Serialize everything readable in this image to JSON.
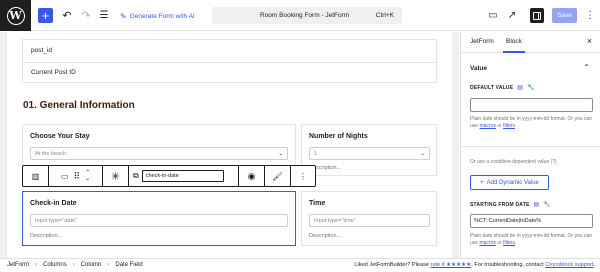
{
  "topbar": {
    "add_icon": "plus-icon",
    "undo_icon": "undo-icon",
    "redo_icon": "redo-icon",
    "outline_icon": "list-view-icon",
    "generate_label": "Generate Form with AI",
    "doc_title": "Room Booking Form - JetForm",
    "doc_shortcut": "Ctrl+K",
    "save_label": "Save",
    "accent": "#3858e9"
  },
  "canvas": {
    "post_id_label": "post_id",
    "current_post_label": "Current Post ID",
    "section_title": "01. General Information",
    "stay": {
      "label": "Choose Your Stay",
      "value": "At the beach",
      "desc": "Description..."
    },
    "nights": {
      "label": "Number of Nights",
      "value": "1",
      "desc": "Description..."
    },
    "checkin": {
      "label": "Check-in Date",
      "placeholder": "Input type=\"date\"",
      "desc": "Description..."
    },
    "time": {
      "label": "Time",
      "placeholder": "Input type=\"time\"",
      "desc": "Description..."
    },
    "block_toolbar": {
      "name_value": "check-in-date"
    }
  },
  "sidebar": {
    "tabs": [
      "JetForm",
      "Block"
    ],
    "active_tab": "Block",
    "panel_title": "Value",
    "default_value_label": "DEFAULT VALUE",
    "help1_prefix": "Plain date should be in yyyy-mm-dd format. Or you can use ",
    "help1_macros": "macros",
    "help1_or": " or ",
    "help1_filters": "filters",
    "help1_end": ".",
    "condition_text": "Or use a condition-dependent value (?)",
    "add_dynamic_label": "Add Dynamic Value",
    "starting_label": "STARTING FROM DATE",
    "starting_value": "%CT::CurrentDate|toDate%",
    "help2_prefix": "Plain date should be in yyyy-mm-dd format. Or you can use ",
    "help2_macros": "macros",
    "help2_or": " or ",
    "help2_filters": "filters",
    "help2_end": "."
  },
  "footer": {
    "crumbs": [
      "JetForm",
      "Columns",
      "Column",
      "Date Field"
    ],
    "note_prefix": "Liked JetFormBuilder? Please ",
    "note_rate": "rate it ★★★★★",
    "note_mid": ". For troubleshooting, contact ",
    "note_support": "Crocoblock support",
    "note_end": "."
  }
}
